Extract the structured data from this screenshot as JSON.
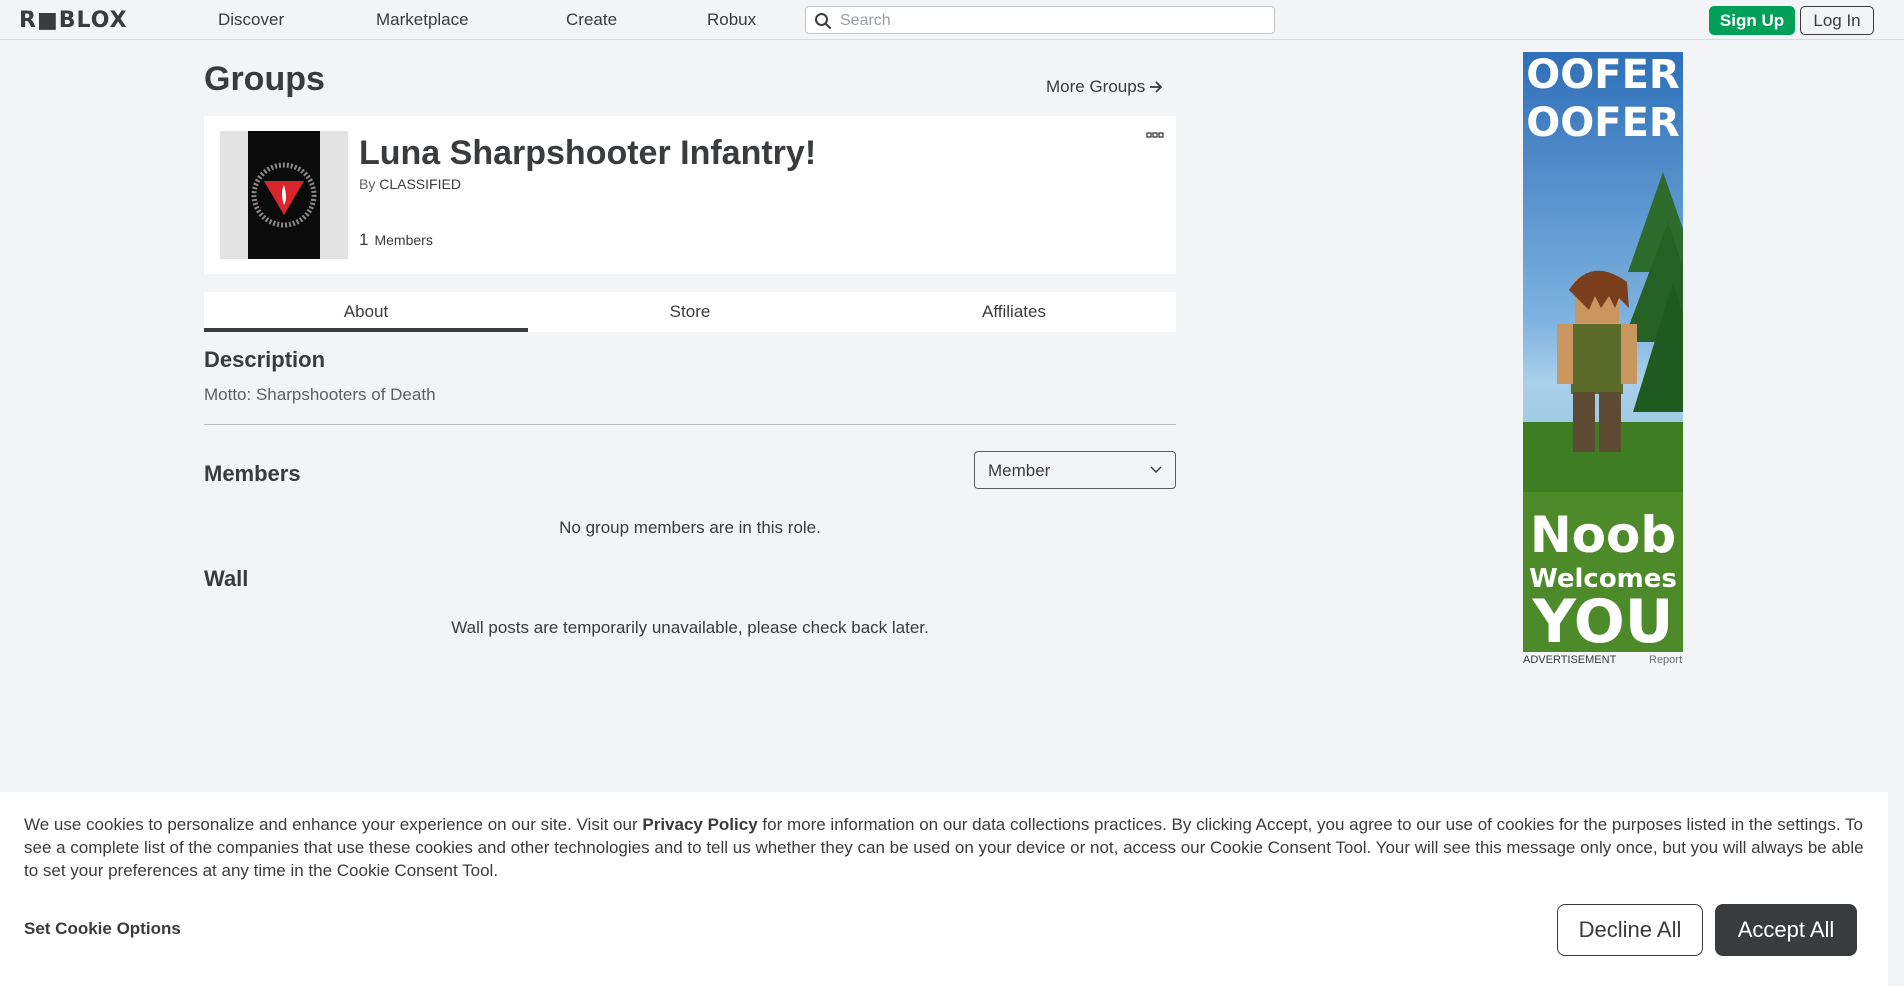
{
  "nav": {
    "logo": "R■BLOX",
    "links": [
      "Discover",
      "Marketplace",
      "Create",
      "Robux"
    ],
    "search_placeholder": "Search",
    "signup": "Sign Up",
    "login": "Log In"
  },
  "page": {
    "title": "Groups",
    "more_groups": "More Groups"
  },
  "group": {
    "name": "Luna Sharpshooter Infantry!",
    "by_label": "By",
    "owner": "CLASSIFIED",
    "member_count": "1",
    "member_label": "Members"
  },
  "tabs": [
    "About",
    "Store",
    "Affiliates"
  ],
  "about": {
    "description_title": "Description",
    "description_text": "Motto: Sharpshooters of Death",
    "members_title": "Members",
    "role_selected": "Member",
    "members_empty": "No group members are in this role.",
    "wall_title": "Wall",
    "wall_message": "Wall posts are temporarily unavailable, please check back later."
  },
  "ad": {
    "line1": "OOFER",
    "line2": "OOFER",
    "line3": "Noob",
    "line4": "Welcomes",
    "line5": "YOU",
    "label": "ADVERTISEMENT",
    "report": "Report"
  },
  "cookie": {
    "text_before": "We use cookies to personalize and enhance your experience on our site. Visit our ",
    "link": "Privacy Policy",
    "text_after": " for more information on our data collections practices. By clicking Accept, you agree to our use of cookies for the purposes listed in the settings. To see a complete list of the companies that use these cookies and other technologies and to tell us whether they can be used on your device or not, access our Cookie Consent Tool. Your will see this message only once, but you will always be able to set your preferences at any time in the Cookie Consent Tool.",
    "set_options": "Set Cookie Options",
    "decline": "Decline All",
    "accept": "Accept All"
  },
  "colors": {
    "background": "#f2f4f5",
    "signup_green": "#00a05a",
    "text_dark": "#393b3d",
    "ad_green": "#3c6e1f"
  }
}
